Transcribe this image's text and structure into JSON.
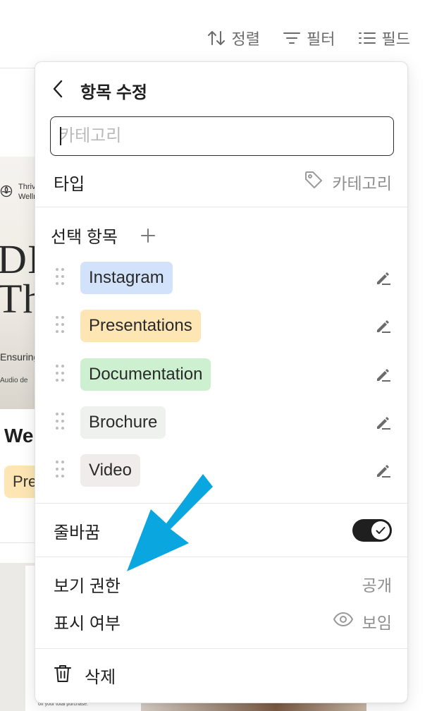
{
  "toolbar": {
    "sort_label": "정렬",
    "filter_label": "필터",
    "fields_label": "필드"
  },
  "background": {
    "brand_line1": "Thriv",
    "brand_line2": "Welln",
    "big_line1": "DIY",
    "big_line2": "Th",
    "ensuring": "Ensuring",
    "audio": "Audio de",
    "card_title": "We",
    "card_tag": "Pre",
    "fine_print": "off your total purchase."
  },
  "panel": {
    "title": "항목 수정",
    "name_placeholder": "카테고리",
    "type_label": "타입",
    "type_value": "카테고리",
    "options_title": "선택 항목",
    "options": [
      {
        "label": "Instagram",
        "color": "#d3e2fb"
      },
      {
        "label": "Presentations",
        "color": "#fde6b3"
      },
      {
        "label": "Documentation",
        "color": "#cdf1d0"
      },
      {
        "label": "Brochure",
        "color": "#eef1ee"
      },
      {
        "label": "Video",
        "color": "#efeceb"
      }
    ],
    "wrap_label": "줄바꿈",
    "wrap_enabled": true,
    "view_permission_label": "보기 권한",
    "view_permission_value": "공개",
    "visibility_label": "표시 여부",
    "visibility_value": "보임",
    "delete_label": "삭제"
  },
  "colors": {
    "accent_arrow": "#0aa6e0",
    "toggle_on": "#1f1f1f"
  }
}
